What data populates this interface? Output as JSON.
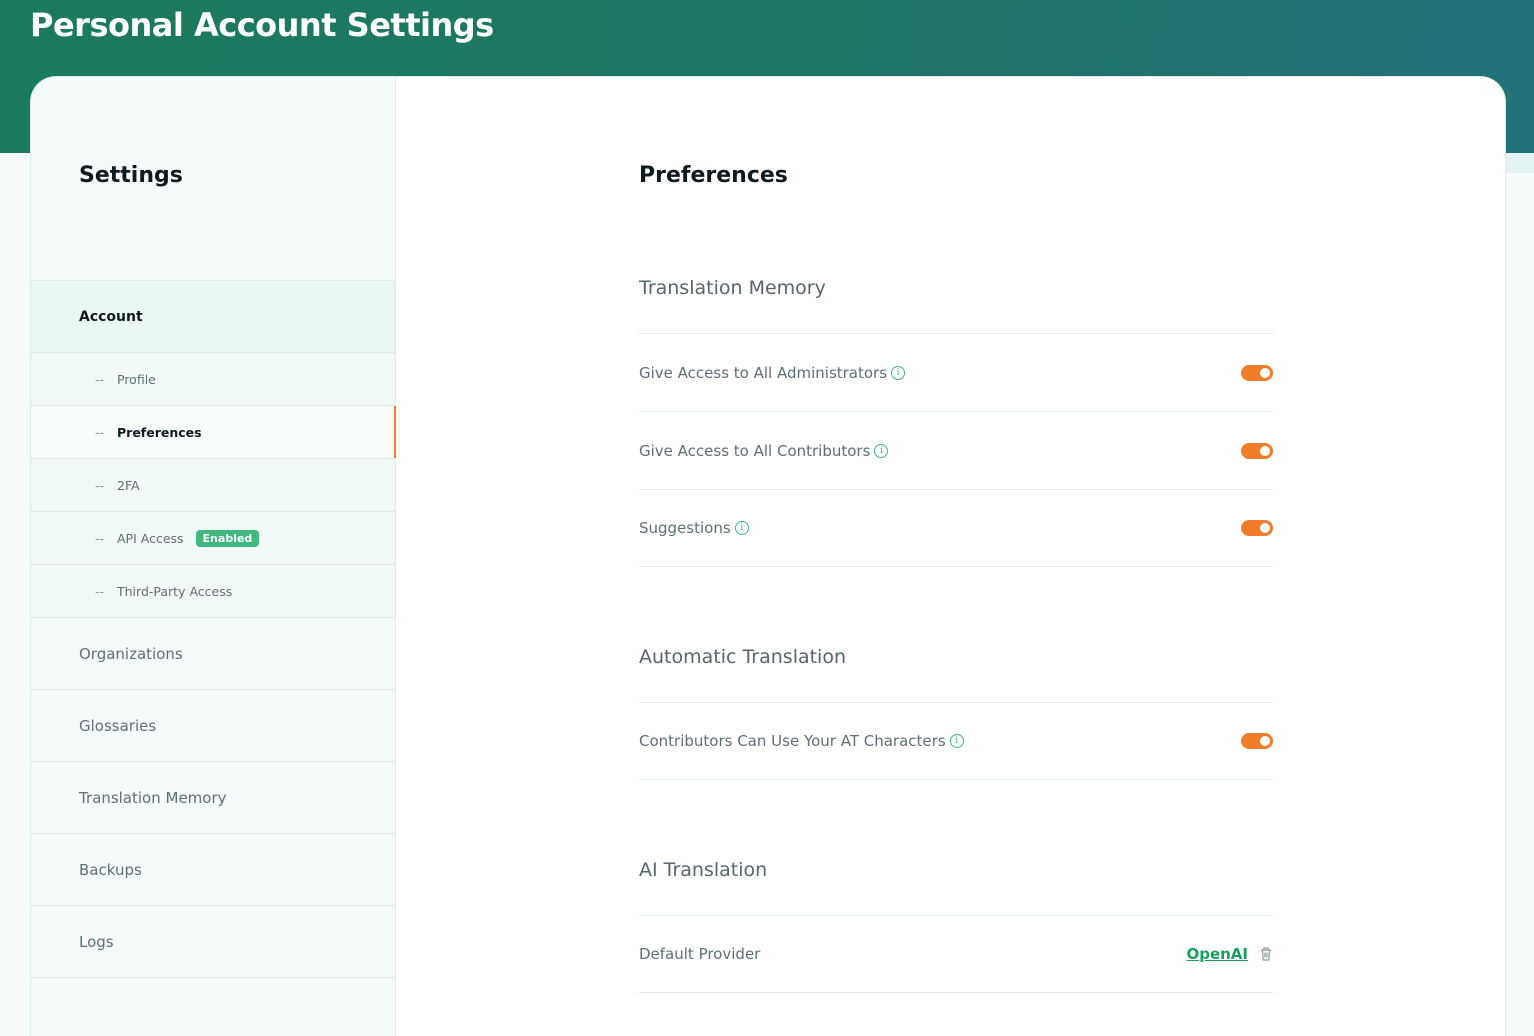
{
  "header": {
    "title": "Personal Account Settings"
  },
  "sidebar": {
    "title": "Settings",
    "account_label": "Account",
    "sub_items": [
      {
        "label": "Profile",
        "active": false
      },
      {
        "label": "Preferences",
        "active": true
      },
      {
        "label": "2FA",
        "active": false
      },
      {
        "label": "API Access",
        "active": false,
        "badge": "Enabled"
      },
      {
        "label": "Third-Party Access",
        "active": false
      }
    ],
    "sections": [
      "Organizations",
      "Glossaries",
      "Translation Memory",
      "Backups",
      "Logs"
    ],
    "dash": "--"
  },
  "main": {
    "title": "Preferences",
    "translation_memory": {
      "heading": "Translation Memory",
      "rows": [
        {
          "label": "Give Access to All Administrators",
          "enabled": true
        },
        {
          "label": "Give Access to All Contributors",
          "enabled": true
        },
        {
          "label": "Suggestions",
          "enabled": true
        }
      ]
    },
    "automatic_translation": {
      "heading": "Automatic Translation",
      "rows": [
        {
          "label": "Contributors Can Use Your AT Characters",
          "enabled": true
        }
      ]
    },
    "ai_translation": {
      "heading": "AI Translation",
      "default_provider_label": "Default Provider",
      "default_provider_value": "OpenAI"
    },
    "info_glyph": "i"
  },
  "colors": {
    "accent": "#f07d2a",
    "brand_green": "#3fb980",
    "banner": "#1f7566"
  },
  "icons": {
    "info": "info-circle-icon",
    "delete": "trash-icon"
  }
}
